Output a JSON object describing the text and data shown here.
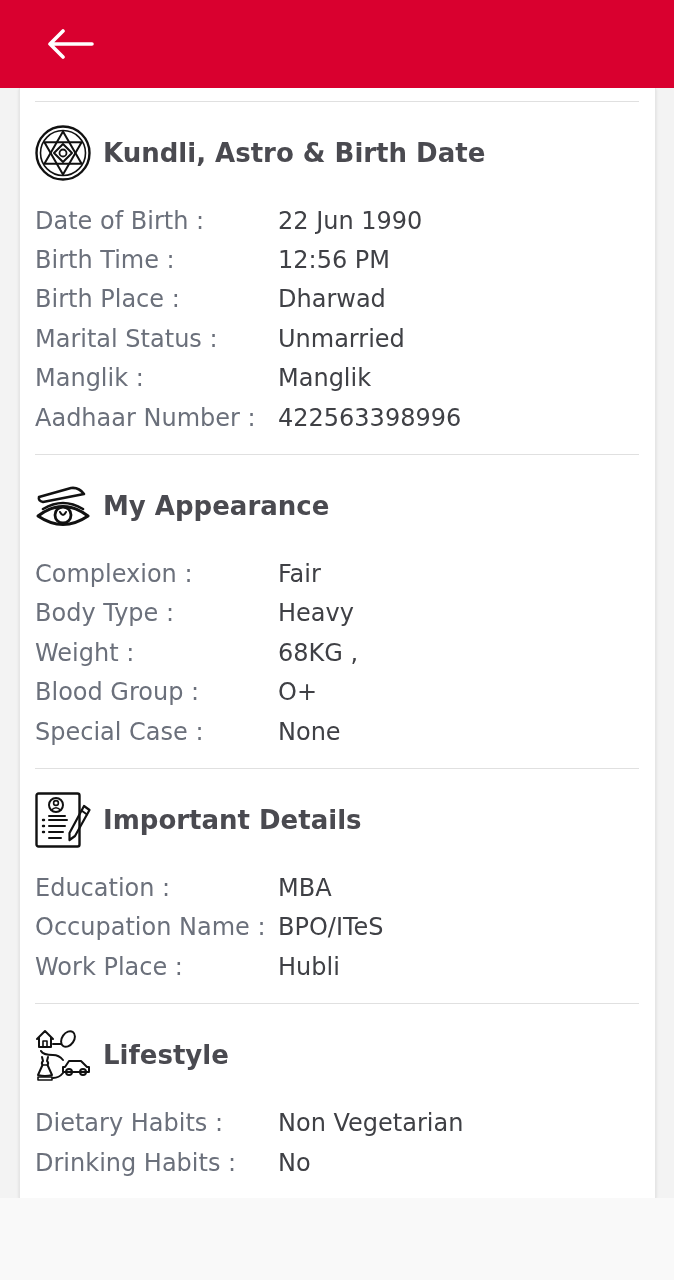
{
  "sections": [
    {
      "kind": "kundli",
      "title": "Kundli, Astro & Birth Date",
      "rows": [
        {
          "label": "Date of Birth :",
          "value": "22 Jun 1990"
        },
        {
          "label": "Birth Time :",
          "value": "12:56 PM"
        },
        {
          "label": "Birth Place :",
          "value": "Dharwad"
        },
        {
          "label": "Marital Status :",
          "value": "Unmarried"
        },
        {
          "label": "Manglik :",
          "value": "Manglik"
        },
        {
          "label": "Aadhaar Number :",
          "value": "422563398996"
        }
      ]
    },
    {
      "kind": "appearance",
      "title": "My Appearance",
      "rows": [
        {
          "label": "Complexion :",
          "value": "Fair"
        },
        {
          "label": "Body Type :",
          "value": "Heavy"
        },
        {
          "label": "Weight :",
          "value": "68KG ,"
        },
        {
          "label": "Blood Group :",
          "value": "O+"
        },
        {
          "label": "Special Case :",
          "value": "None"
        }
      ]
    },
    {
      "kind": "details",
      "title": "Important Details",
      "rows": [
        {
          "label": "Education :",
          "value": "MBA"
        },
        {
          "label": "Occupation Name :",
          "value": "BPO/ITeS"
        },
        {
          "label": "Work Place :",
          "value": "Hubli"
        }
      ]
    },
    {
      "kind": "lifestyle",
      "title": "Lifestyle",
      "rows": [
        {
          "label": "Dietary Habits :",
          "value": "Non Vegetarian"
        },
        {
          "label": "Drinking Habits :",
          "value": "No"
        }
      ]
    }
  ]
}
